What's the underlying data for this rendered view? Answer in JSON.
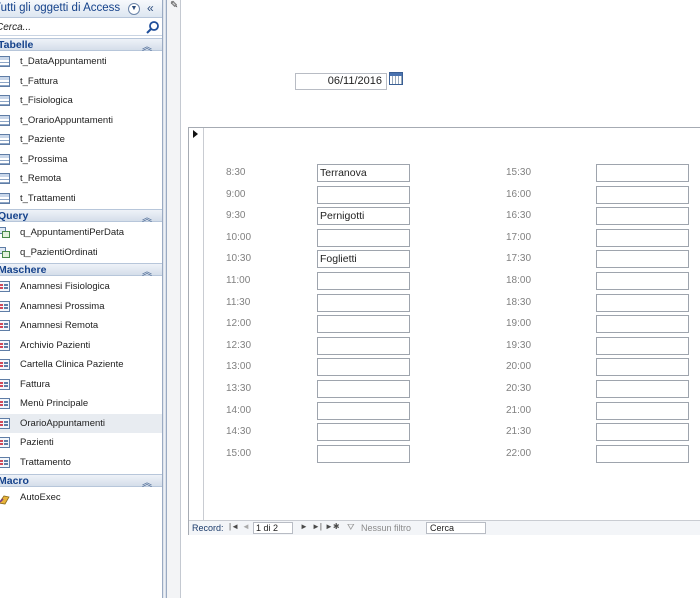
{
  "nav_pane": {
    "title": "Tutti gli oggetti di Access",
    "dropdown_icon": "chevron-down-circle-icon",
    "collapse_icon": "double-chevron-left-icon",
    "search": {
      "value": "",
      "placeholder": "Cerca..."
    },
    "groups": {
      "tables": {
        "title": "Tabelle",
        "items": [
          "t_DataAppuntamenti",
          "t_Fattura",
          "t_Fisiologica",
          "t_OrarioAppuntamenti",
          "t_Paziente",
          "t_Prossima",
          "t_Remota",
          "t_Trattamenti"
        ]
      },
      "queries": {
        "title": "Query",
        "items": [
          "q_AppuntamentiPerData",
          "q_PazientiOrdinati"
        ]
      },
      "forms": {
        "title": "Maschere",
        "items": [
          "Anamnesi Fisiologica",
          "Anamnesi Prossima",
          "Anamnesi Remota",
          "Archivio Pazienti",
          "Cartella Clinica Paziente",
          "Fattura",
          "Menù Principale",
          "OrarioAppuntamenti",
          "Pazienti",
          "Trattamento"
        ],
        "selected": "OrarioAppuntamenti"
      },
      "macros": {
        "title": "Macro",
        "items": [
          "AutoExec"
        ]
      }
    }
  },
  "form": {
    "date_value": "06/11/2016",
    "slots_left": [
      {
        "time": "8:30",
        "value": "Terranova"
      },
      {
        "time": "9:00",
        "value": ""
      },
      {
        "time": "9:30",
        "value": "Pernigotti"
      },
      {
        "time": "10:00",
        "value": ""
      },
      {
        "time": "10:30",
        "value": "Foglietti"
      },
      {
        "time": "11:00",
        "value": ""
      },
      {
        "time": "11:30",
        "value": ""
      },
      {
        "time": "12:00",
        "value": ""
      },
      {
        "time": "12:30",
        "value": ""
      },
      {
        "time": "13:00",
        "value": ""
      },
      {
        "time": "13:30",
        "value": ""
      },
      {
        "time": "14:00",
        "value": ""
      },
      {
        "time": "14:30",
        "value": ""
      },
      {
        "time": "15:00",
        "value": ""
      }
    ],
    "slots_right": [
      {
        "time": "15:30",
        "value": ""
      },
      {
        "time": "16:00",
        "value": ""
      },
      {
        "time": "16:30",
        "value": ""
      },
      {
        "time": "17:00",
        "value": ""
      },
      {
        "time": "17:30",
        "value": ""
      },
      {
        "time": "18:00",
        "value": ""
      },
      {
        "time": "18:30",
        "value": ""
      },
      {
        "time": "19:00",
        "value": ""
      },
      {
        "time": "19:30",
        "value": ""
      },
      {
        "time": "20:00",
        "value": ""
      },
      {
        "time": "20:30",
        "value": ""
      },
      {
        "time": "21:00",
        "value": ""
      },
      {
        "time": "21:30",
        "value": ""
      },
      {
        "time": "22:00",
        "value": ""
      }
    ]
  },
  "record_nav": {
    "label": "Record:",
    "first": "|◄",
    "prev": "◄",
    "position": "1 di 2",
    "next": "►",
    "last": "►|",
    "new": "►✱",
    "filter_icon": "filter-funnel-icon",
    "filter_status": "Nessun filtro",
    "search_label": "Cerca"
  }
}
